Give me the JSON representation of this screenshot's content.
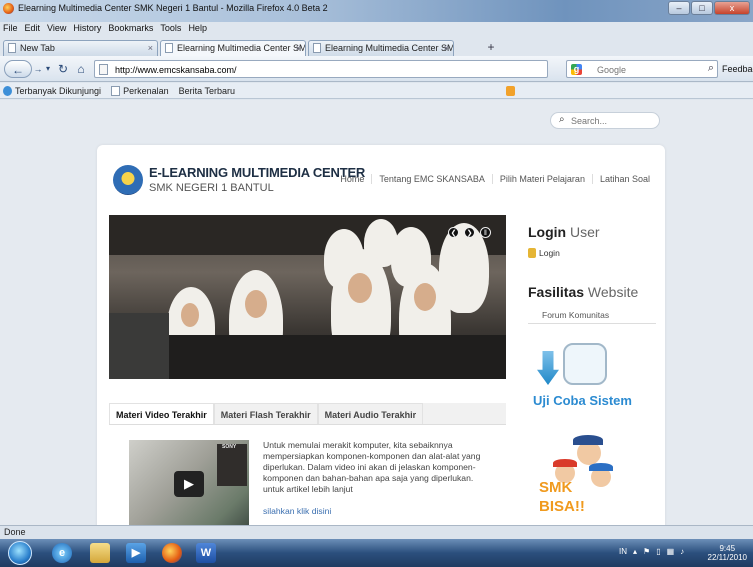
{
  "window": {
    "title": "Elearning Multimedia Center SMK Negeri 1 Bantul - Mozilla Firefox 4.0 Beta 2",
    "buttons": [
      "–",
      "□",
      "x"
    ]
  },
  "menu": [
    "File",
    "Edit",
    "View",
    "History",
    "Bookmarks",
    "Tools",
    "Help"
  ],
  "tabs": [
    {
      "label": "New Tab"
    },
    {
      "label": "Elearning Multimedia Center SMK N..."
    },
    {
      "label": "Elearning Multimedia Center SMK N..."
    }
  ],
  "newtab_label": "+",
  "nav": {
    "url": "http://www.emcskansaba.com/",
    "search_placeholder": "Google",
    "feedback": "Feedback"
  },
  "bookmarks": [
    "Terbanyak Dikunjungi",
    "Perkenalan",
    "Berita Terbaru"
  ],
  "site": {
    "search_placeholder": "Search...",
    "title": "E-LEARNING MULTIMEDIA CENTER",
    "subtitle": "SMK NEGERI 1 BANTUL",
    "nav": [
      "Home",
      "Tentang EMC SKANSABA",
      "Pilih Materi Pelajaran",
      "Latihan Soal"
    ],
    "tabs": [
      "Materi Video Terakhir",
      "Materi Flash Terakhir",
      "Materi Audio Terakhir"
    ],
    "thumb_label": "SONY",
    "video_text": "Untuk memulai merakit komputer, kita sebaiknnya mempersiapkan komponen-komponen dan alat-alat yang diperlukan. Dalam video ini akan di jelaskan komponen-komponen dan bahan-bahan apa saja yang diperlukan. untuk artikel lebih lanjut",
    "video_link": "silahkan klik disini",
    "login_title_bold": "Login",
    "login_title_rest": "User",
    "login_link": "Login",
    "fasilitas_bold": "Fasilitas",
    "fasilitas_rest": "Website",
    "forum": "Forum Komunitas",
    "uji_text": "Uji Coba Sistem",
    "smk_text1": "SMK",
    "smk_text2": "BISA!!"
  },
  "status": "Done",
  "taskbar": {
    "tray_lang": "IN",
    "clock_time": "9:45",
    "clock_date": "22/11/2010"
  }
}
